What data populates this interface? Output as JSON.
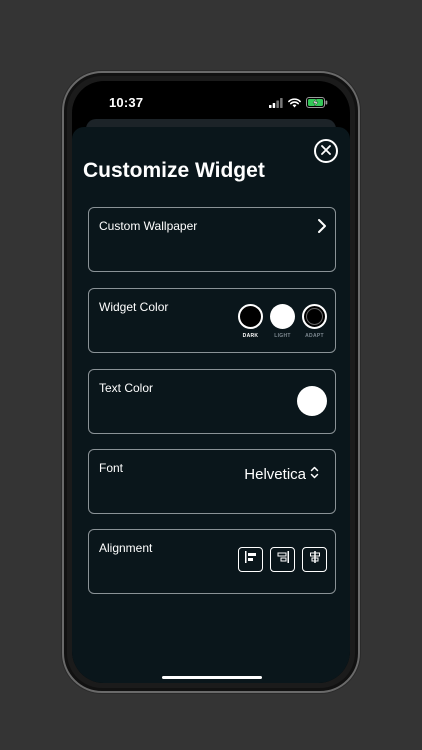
{
  "status_bar": {
    "time": "10:37",
    "icons": [
      "signal-icon",
      "wifi-icon",
      "battery-charging-icon"
    ]
  },
  "header": {
    "title": "Customize Widget",
    "close_icon": "close-circle-icon"
  },
  "cards": {
    "wallpaper": {
      "label": "Custom Wallpaper",
      "icon": "chevron-right-icon"
    },
    "widget_color": {
      "label": "Widget Color",
      "options": [
        {
          "label": "DARK",
          "color": "#000000",
          "label_color": "#ffffff"
        },
        {
          "label": "LIGHT",
          "color": "#ffffff",
          "label_color": "#7d8890"
        },
        {
          "label": "ADAPT",
          "color": "#000000",
          "label_color": "#7d8890"
        }
      ],
      "selected": "DARK"
    },
    "text_color": {
      "label": "Text Color",
      "value_color": "#ffffff"
    },
    "font": {
      "label": "Font",
      "value": "Helvetica",
      "icon": "chevron-up-down-icon"
    },
    "alignment": {
      "label": "Alignment",
      "options": [
        "align-left-icon",
        "align-right-icon",
        "align-center-icon"
      ]
    }
  },
  "colors": {
    "page_background": "#343434",
    "sheet_background": "#0a161b",
    "card_border": "#8a9296",
    "text": "#ffffff"
  }
}
